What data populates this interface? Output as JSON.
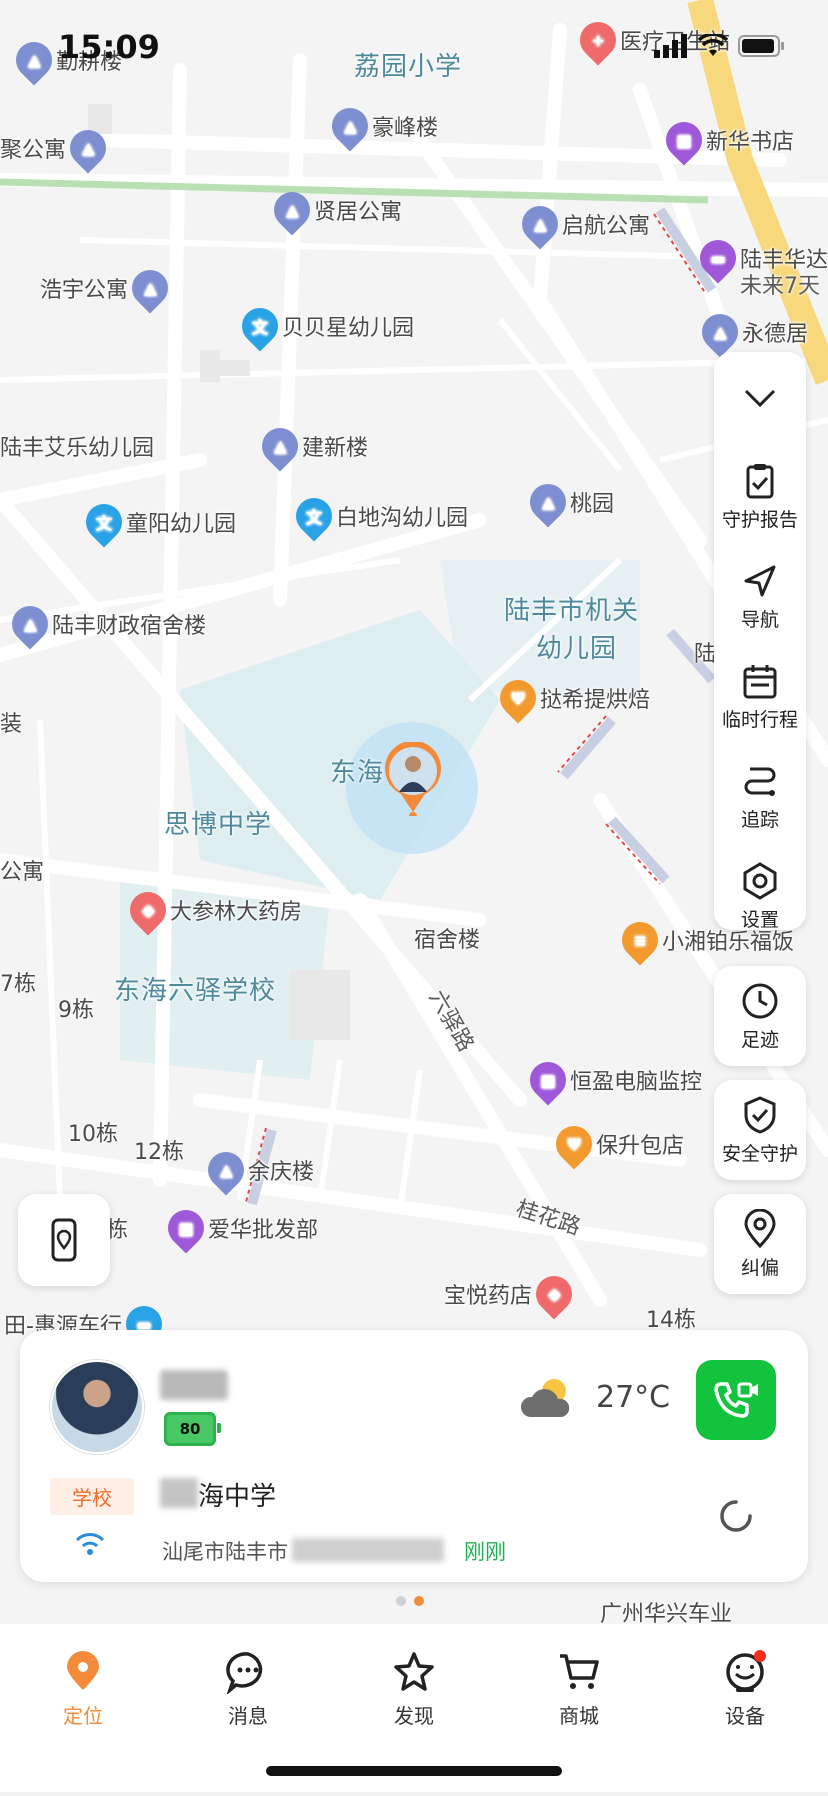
{
  "status_bar": {
    "time": "15:09"
  },
  "map": {
    "areas": {
      "school_top": "荔园小学",
      "kindergarten_big_1": "陆丰市机关",
      "kindergarten_big_2": "幼儿园",
      "dong_hai": "东海",
      "si_bo": "思博中学",
      "dong_hai_six": "东海六驿学校"
    },
    "pois": {
      "qin_geng_lou": "勤耕楼",
      "ju_gong_yu": "聚公寓",
      "hao_feng_lou": "豪峰楼",
      "yi_liao": "医疗卫生站",
      "xin_hua": "新华书店",
      "xian_ju": "贤居公寓",
      "qi_hang": "启航公寓",
      "lufeng_hua": "陆丰华达",
      "wei_lai": "未来7天",
      "hao_yu": "浩宇公寓",
      "bei_bei": "贝贝星幼儿园",
      "yong_de": "永德居",
      "ai_le": "陆丰艾乐幼儿园",
      "jian_xin": "建新楼",
      "tong_yang": "童阳幼儿园",
      "bai_di": "白地沟幼儿园",
      "tao_yuan": "桃园",
      "cai_zheng": "陆丰财政宿舍楼",
      "ting_xi": "挞希提烘焙",
      "zhuang": "装",
      "gong_yu": "公寓",
      "da_shen": "大参林大药房",
      "su_she": "宿舍楼",
      "xiao_xiang": "小湘铂乐福饭",
      "qi_dong": "7栋",
      "jiu_dong": "9栋",
      "heng_ying": "恒盈电脑监控",
      "shi_dong": "10栋",
      "shi_er_dong": "12栋",
      "yu_qing": "余庆楼",
      "bao_sheng": "保升包店",
      "ai_hua": "爱华批发部",
      "dong": "栋",
      "bao_yue": "宝悦药店",
      "shi_si_dong": "14栋",
      "hui_yuan": "田-惠源车行",
      "guang_zhou": "广州华兴车业",
      "lu_dian": "陆"
    },
    "streets": {
      "liu_yi": "六驿路",
      "gui_hua": "桂花路"
    }
  },
  "toolbar": {
    "collapse": "",
    "report": "守护报告",
    "navigate": "导航",
    "temp_schedule": "临时行程",
    "track": "追踪",
    "settings": "设置",
    "footprint": "足迹",
    "safety": "安全守护",
    "correct": "纠偏"
  },
  "card": {
    "battery": "80",
    "temperature": "27°C",
    "tag": "学校",
    "school_name": "海中学",
    "address": "汕尾市陆丰市",
    "address_time": "刚刚",
    "accent": "#13c33d"
  },
  "tabs": [
    {
      "label": "定位",
      "icon": "location-icon"
    },
    {
      "label": "消息",
      "icon": "message-icon"
    },
    {
      "label": "发现",
      "icon": "star-icon"
    },
    {
      "label": "商城",
      "icon": "cart-icon"
    },
    {
      "label": "设备",
      "icon": "device-icon"
    }
  ],
  "colors": {
    "brand": "#f38b3a",
    "green": "#13c33d"
  }
}
